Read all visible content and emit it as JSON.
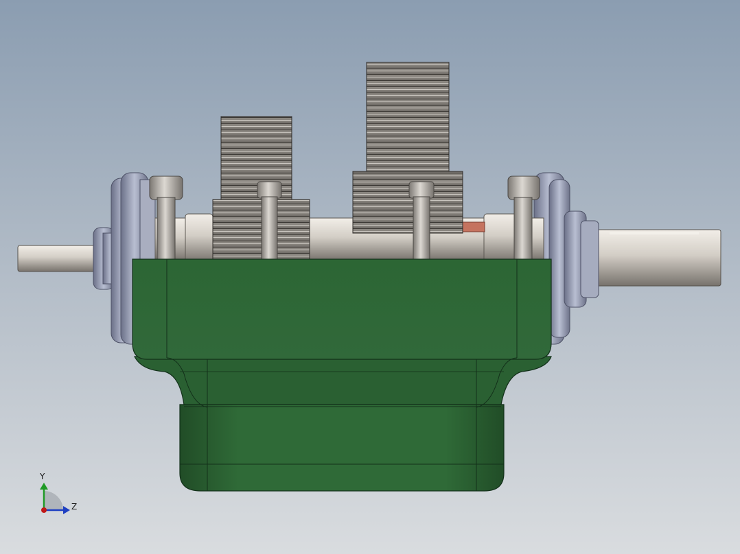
{
  "view": {
    "background_top": "#8b9db1",
    "background_bottom": "#d9dcdf"
  },
  "colors": {
    "housing": "#2f6a37",
    "shaft": "#d3cec6",
    "gear": "#8f8b86",
    "bearing": "#9aa1b6",
    "accent_copper": "#c5735f"
  },
  "triad": {
    "y_label": "Y",
    "z_label": "Z",
    "y_color": "#1f9a25",
    "z_color": "#1e3fc2",
    "x_color": "#c01818"
  }
}
